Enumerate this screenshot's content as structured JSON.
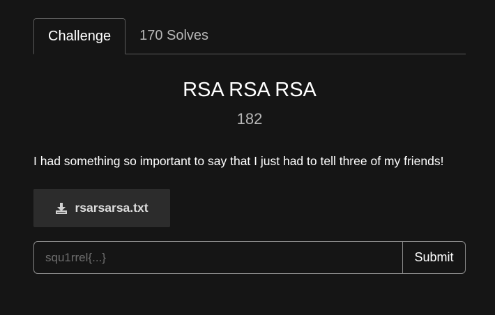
{
  "tabs": [
    {
      "label": "Challenge",
      "active": true
    },
    {
      "label": "170 Solves",
      "active": false
    }
  ],
  "challenge": {
    "name": "RSA RSA RSA",
    "points": "182",
    "description": "I had something so important to say that I just had to tell three of my friends!"
  },
  "file": {
    "icon": "download-icon",
    "name": "rsarsarsa.txt"
  },
  "submission": {
    "placeholder": "squ1rrel{...}",
    "value": "",
    "submit_label": "Submit"
  }
}
